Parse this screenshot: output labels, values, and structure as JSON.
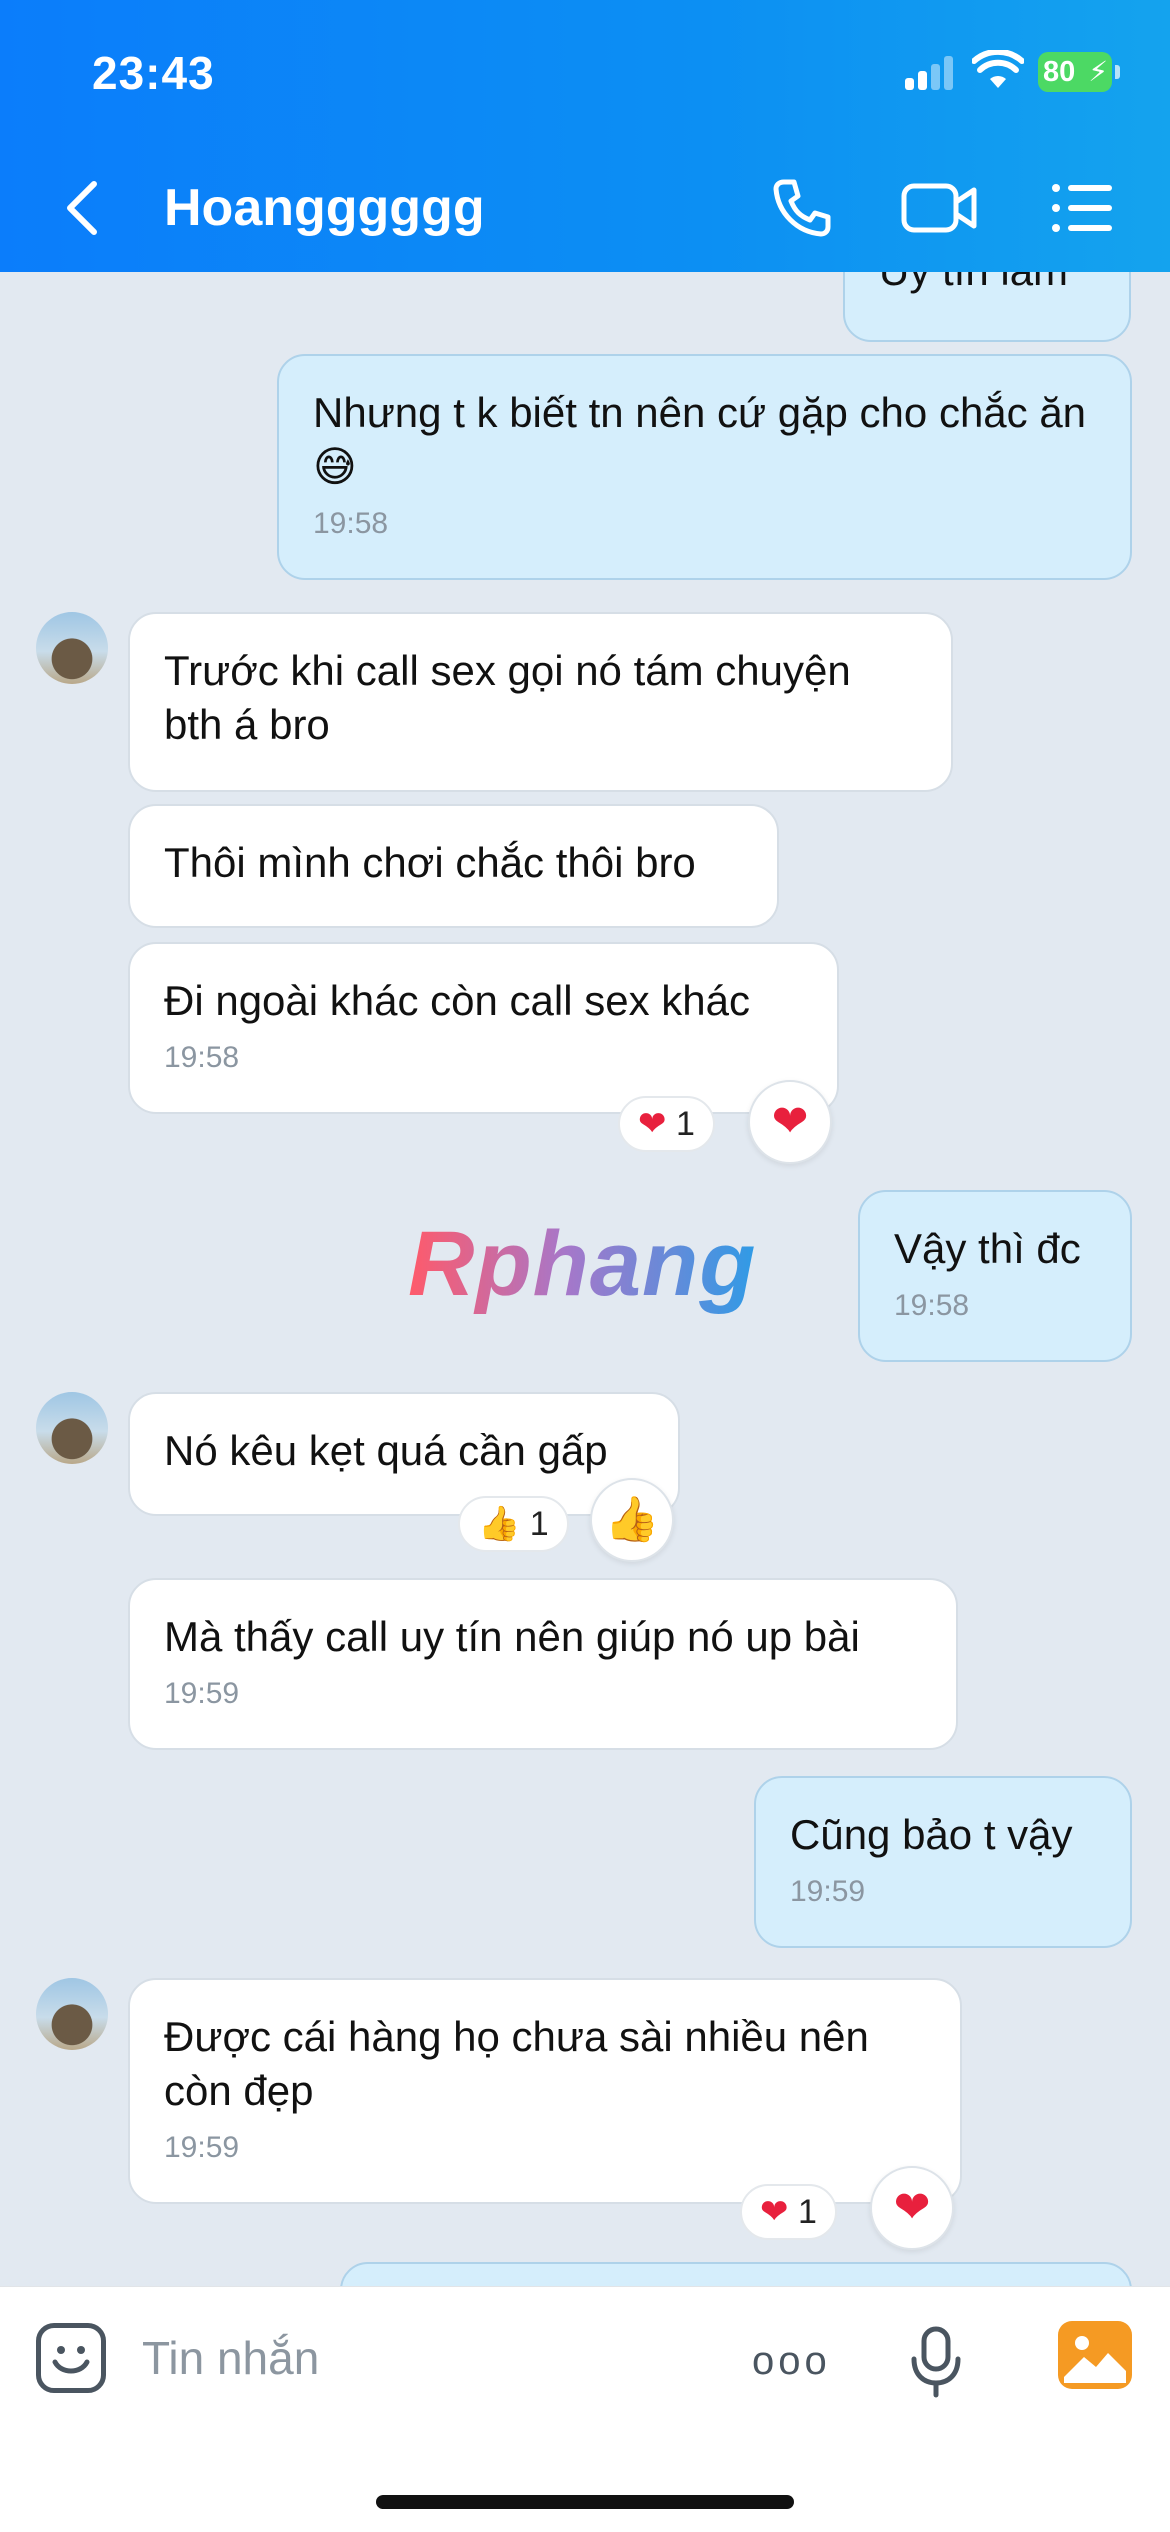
{
  "status_bar": {
    "time": "23:43",
    "battery": "80"
  },
  "header": {
    "contact_name": "Hoangggggg"
  },
  "messages": [
    {
      "text": "Uy tín lắm"
    },
    {
      "text": "Nhưng t k biết tn nên cứ gặp cho chắc ăn😅",
      "time": "19:58"
    },
    {
      "text": "Trước khi call sex gọi nó tám chuyện bth á bro"
    },
    {
      "text": "Thôi mình chơi chắc thôi bro"
    },
    {
      "text": "Đi ngoài khác còn call sex khác",
      "time": "19:58",
      "reaction_count": "1"
    },
    {
      "text": "Vậy thì đc",
      "time": "19:58"
    },
    {
      "text": "Nó kêu kẹt quá cần gấp",
      "reaction_count": "1"
    },
    {
      "text": "Mà thấy call uy tín nên giúp nó up bài",
      "time": "19:59"
    },
    {
      "text": "Cũng bảo t vậy",
      "time": "19:59"
    },
    {
      "text": "Được cái hàng họ chưa sài nhiều nên còn đẹp",
      "time": "19:59",
      "reaction_count": "1"
    }
  ],
  "watermark": "Rphang",
  "composer": {
    "placeholder": "Tin nhắn",
    "more": "ooo"
  },
  "colors": {
    "header_start": "#0b7dfb",
    "header_end": "#14a3ee",
    "out_bubble": "#d5eefc",
    "in_bubble": "#ffffff",
    "chat_bg": "#e2e9f1"
  }
}
